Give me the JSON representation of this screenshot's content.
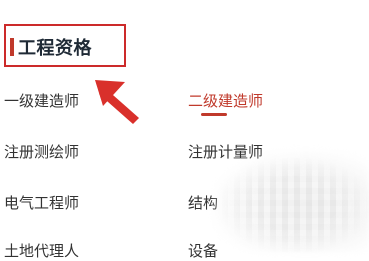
{
  "section": {
    "title": "工程资格"
  },
  "qualifications": [
    {
      "label": "一级建造师",
      "active": false
    },
    {
      "label": "二级建造师",
      "active": true
    },
    {
      "label": "注册测绘师",
      "active": false
    },
    {
      "label": "注册计量师",
      "active": false
    },
    {
      "label": "电气工程师",
      "active": false
    },
    {
      "label": "结构",
      "active": false
    },
    {
      "label": "土地代理人",
      "active": false
    },
    {
      "label": "设备",
      "active": false
    }
  ],
  "colors": {
    "accent": "#c0392b",
    "highlight_box": "#cc2a2a",
    "arrow": "#d9302b",
    "text": "#333333",
    "title": "#1f2a36"
  },
  "icons": {
    "annotation": "red-arrow-icon"
  }
}
